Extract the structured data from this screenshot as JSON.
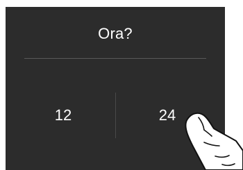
{
  "dialog": {
    "title": "Ora?",
    "options": [
      {
        "label": "12"
      },
      {
        "label": "24"
      }
    ],
    "selected_option": "24"
  },
  "icons": {
    "pointer": "pointing-hand-icon"
  },
  "colors": {
    "background": "#2c2c2c",
    "text": "#ffffff",
    "divider": "#5a5a5a"
  }
}
